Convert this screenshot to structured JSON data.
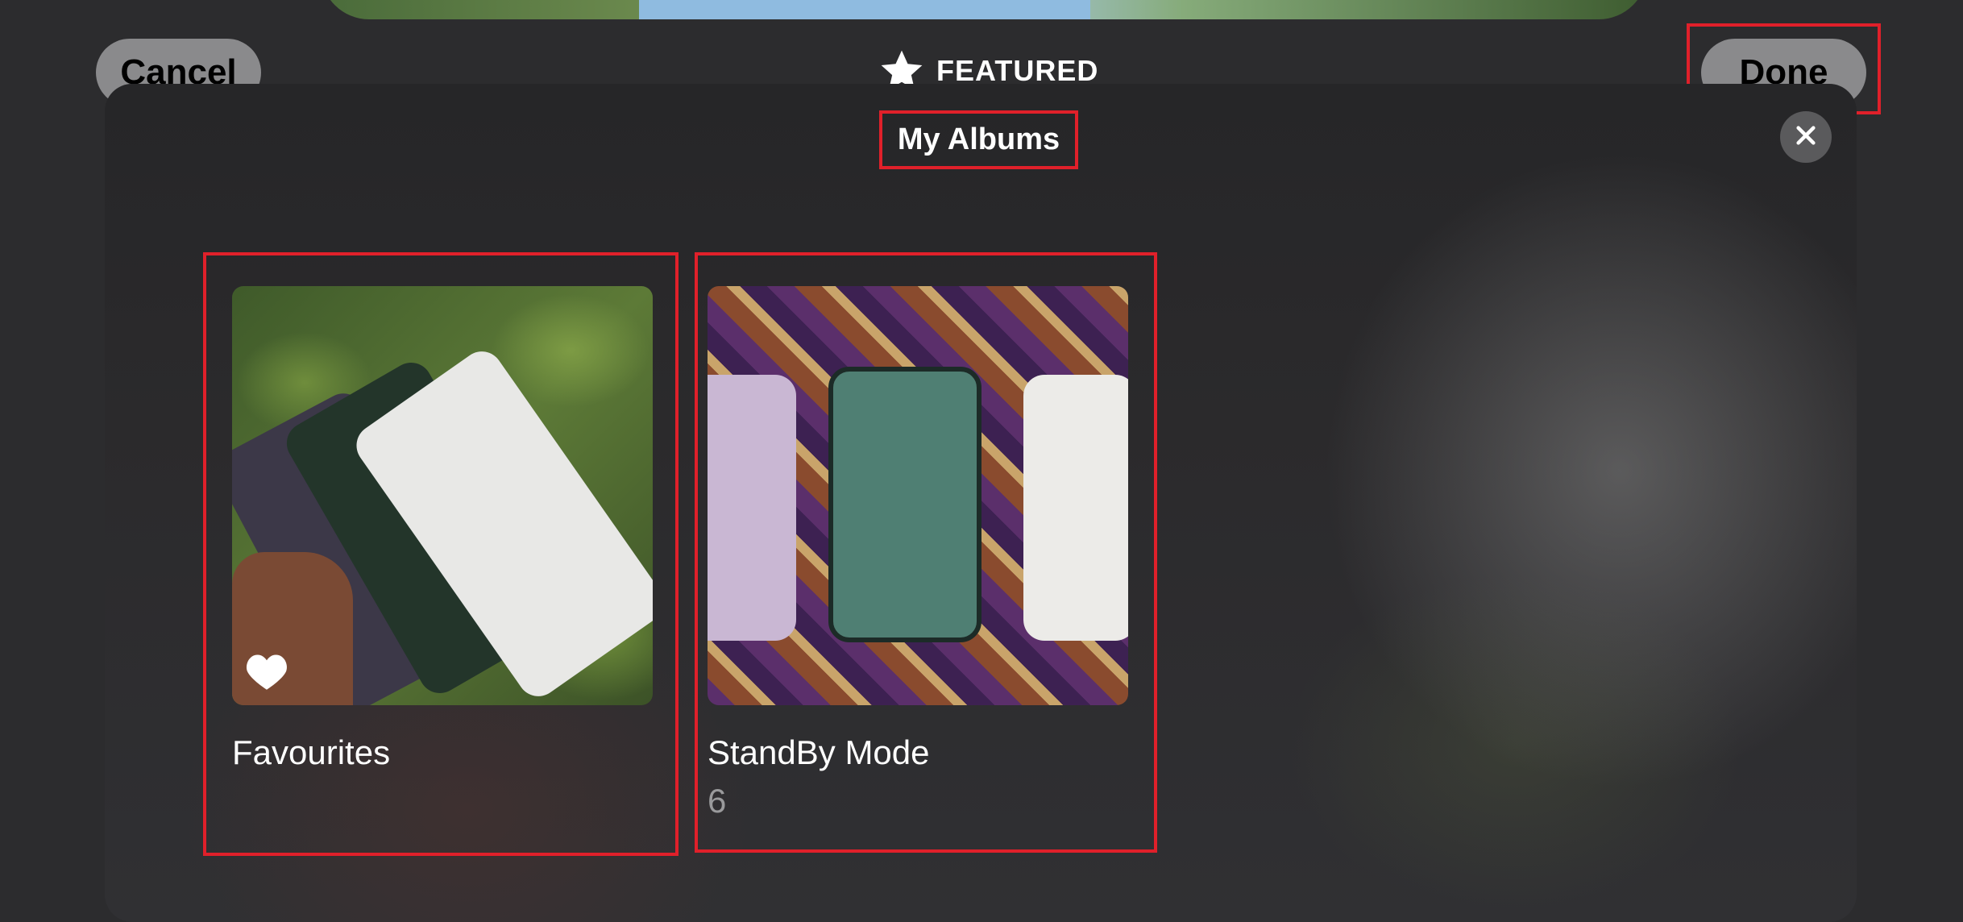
{
  "header": {
    "cancel_label": "Cancel",
    "featured_label": "FEATURED",
    "done_label": "Done"
  },
  "sheet": {
    "title": "My Albums"
  },
  "albums": [
    {
      "name": "Favourites",
      "count": ""
    },
    {
      "name": "StandBy Mode",
      "count": "6"
    }
  ],
  "icons": {
    "featured": "star-icon",
    "close": "close-icon",
    "favourite": "heart-icon"
  },
  "colors": {
    "highlight": "#e0202a",
    "pill_bg": "#8a8a8c",
    "background": "#2c2c2e"
  }
}
